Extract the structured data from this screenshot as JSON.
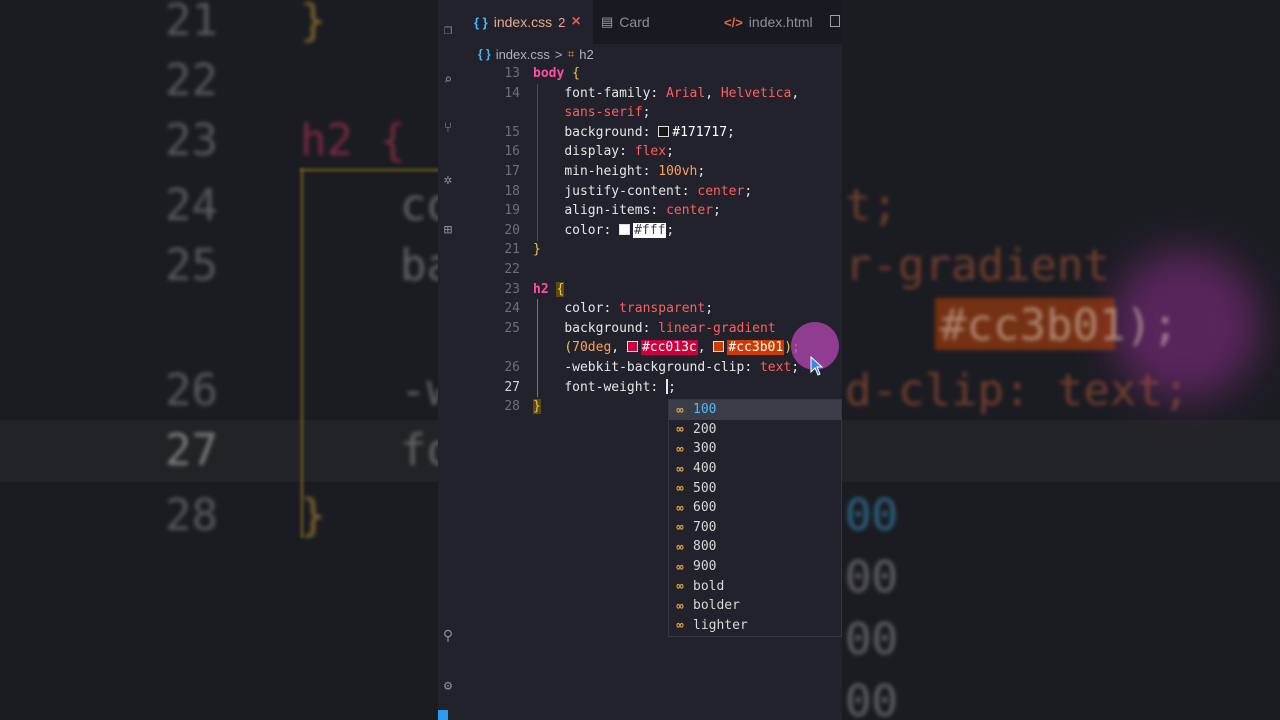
{
  "background": {
    "code_lines": [
      {
        "num": "21",
        "text": "}"
      },
      {
        "num": "22",
        "text": ""
      },
      {
        "num": "23",
        "text": "h2 {"
      },
      {
        "num": "24",
        "text": "co"
      },
      {
        "num": "25",
        "text": "ba"
      },
      {
        "num": "26",
        "text": "-w"
      },
      {
        "num": "27",
        "text": "fo"
      },
      {
        "num": "28",
        "text": "}"
      }
    ],
    "right_fragments": [
      "t;",
      "r-gradient",
      "#cc3b01);",
      "d-clip: text;",
      "00",
      "00",
      "00",
      "00"
    ]
  },
  "tabs": [
    {
      "icon": "{ }",
      "label": "index.css",
      "badge": "2",
      "close": "×",
      "active": true
    },
    {
      "icon": "▤",
      "label": "Card",
      "active": false
    },
    {
      "icon": "</>",
      "label": "index.html",
      "active": false
    }
  ],
  "breadcrumb": {
    "file": "index.css",
    "separator": ">",
    "symbol": "h2"
  },
  "code": {
    "lines": [
      {
        "n": "13"
      },
      {
        "n": "14"
      },
      {
        "n": ""
      },
      {
        "n": "15"
      },
      {
        "n": "16"
      },
      {
        "n": "17"
      },
      {
        "n": "18"
      },
      {
        "n": "19"
      },
      {
        "n": "20"
      },
      {
        "n": "21"
      },
      {
        "n": "22"
      },
      {
        "n": "23"
      },
      {
        "n": "24"
      },
      {
        "n": "25"
      },
      {
        "n": ""
      },
      {
        "n": "26"
      },
      {
        "n": "27"
      },
      {
        "n": "28"
      }
    ],
    "t": {
      "body": "body",
      "ob": "{",
      "cb": "}",
      "ff": "font-family",
      "arial": "Arial",
      "helv": "Helvetica",
      "sans": "sans-serif",
      "bg": "background",
      "bgval": "#171717",
      "disp": "display",
      "flex": "flex",
      "mh": "min-height",
      "vh": "100vh",
      "jc": "justify-content",
      "center": "center",
      "ai": "align-items",
      "color": "color",
      "fff": "#fff",
      "h2": "h2",
      "transparent": "transparent",
      "lg": "linear-gradient",
      "deg": "70deg",
      "pink": "#cc013c",
      "orange": "#cc3b01",
      "clip": "-webkit-background-clip",
      "text": "text",
      "fw": "font-weight",
      "colon": ":",
      "semi": ";",
      "comma": ",",
      "lp": "(",
      "rp": ");"
    }
  },
  "suggestions": [
    "100",
    "200",
    "300",
    "400",
    "500",
    "600",
    "700",
    "800",
    "900",
    "bold",
    "bolder",
    "lighter"
  ],
  "colors": {
    "pink": "#cc013c",
    "orange": "#cc3b01",
    "bg": "#171717",
    "white": "#fff"
  }
}
